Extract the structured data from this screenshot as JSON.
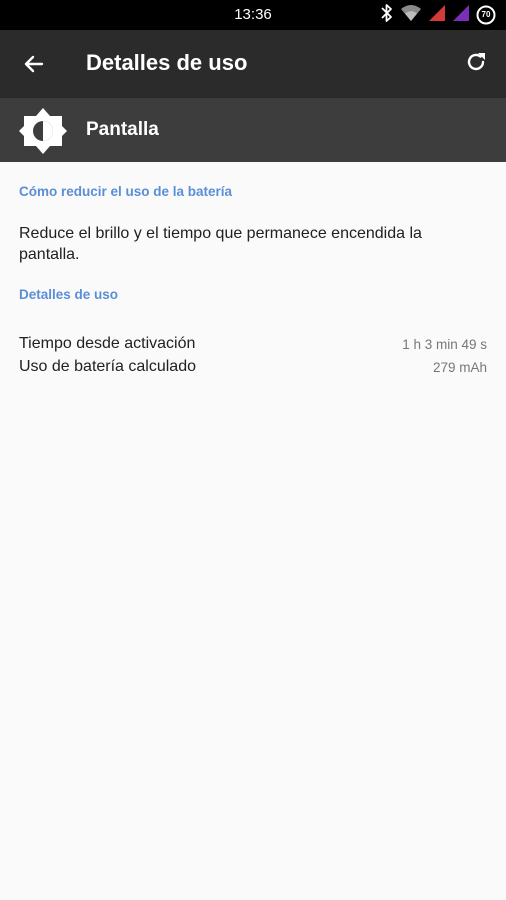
{
  "status_bar": {
    "time": "13:36",
    "battery_level": "70",
    "icons": [
      "bluetooth-icon",
      "wifi-icon",
      "signal-icon",
      "signal-icon",
      "battery-icon"
    ],
    "signal_colors": [
      "#d33a3a",
      "#7b2fb8"
    ]
  },
  "app_bar": {
    "title": "Detalles de uso"
  },
  "header": {
    "label": "Pantalla"
  },
  "tips_section": {
    "title": "Cómo reducir el uso de la batería",
    "text": "Reduce el brillo y el tiempo que permanece encendida la pantalla."
  },
  "details_section": {
    "title": "Detalles de uso",
    "rows": [
      {
        "label": "Tiempo desde activación",
        "value": "1 h 3 min 49 s"
      },
      {
        "label": "Uso de batería calculado",
        "value": "279 mAh"
      }
    ]
  },
  "colors": {
    "accent": "#5a8fd8",
    "app_bar": "#2b2b2b",
    "header_bar": "#3d3d3d",
    "background": "#fafafa"
  }
}
